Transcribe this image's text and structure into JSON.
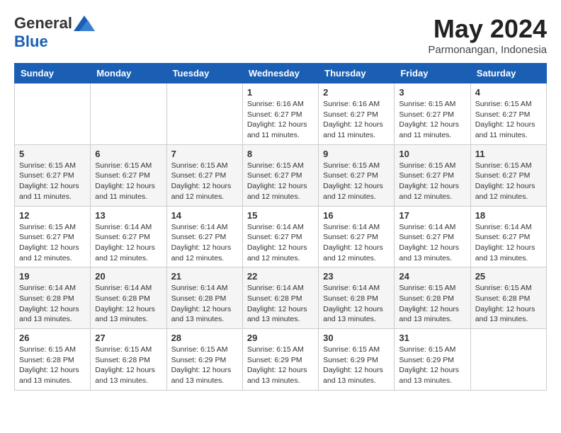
{
  "header": {
    "logo": {
      "general": "General",
      "blue": "Blue"
    },
    "title": "May 2024",
    "location": "Parmonangan, Indonesia"
  },
  "days_of_week": [
    "Sunday",
    "Monday",
    "Tuesday",
    "Wednesday",
    "Thursday",
    "Friday",
    "Saturday"
  ],
  "weeks": [
    [
      {
        "day": "",
        "info": ""
      },
      {
        "day": "",
        "info": ""
      },
      {
        "day": "",
        "info": ""
      },
      {
        "day": "1",
        "info": "Sunrise: 6:16 AM\nSunset: 6:27 PM\nDaylight: 12 hours and 11 minutes."
      },
      {
        "day": "2",
        "info": "Sunrise: 6:16 AM\nSunset: 6:27 PM\nDaylight: 12 hours and 11 minutes."
      },
      {
        "day": "3",
        "info": "Sunrise: 6:15 AM\nSunset: 6:27 PM\nDaylight: 12 hours and 11 minutes."
      },
      {
        "day": "4",
        "info": "Sunrise: 6:15 AM\nSunset: 6:27 PM\nDaylight: 12 hours and 11 minutes."
      }
    ],
    [
      {
        "day": "5",
        "info": "Sunrise: 6:15 AM\nSunset: 6:27 PM\nDaylight: 12 hours and 11 minutes."
      },
      {
        "day": "6",
        "info": "Sunrise: 6:15 AM\nSunset: 6:27 PM\nDaylight: 12 hours and 11 minutes."
      },
      {
        "day": "7",
        "info": "Sunrise: 6:15 AM\nSunset: 6:27 PM\nDaylight: 12 hours and 12 minutes."
      },
      {
        "day": "8",
        "info": "Sunrise: 6:15 AM\nSunset: 6:27 PM\nDaylight: 12 hours and 12 minutes."
      },
      {
        "day": "9",
        "info": "Sunrise: 6:15 AM\nSunset: 6:27 PM\nDaylight: 12 hours and 12 minutes."
      },
      {
        "day": "10",
        "info": "Sunrise: 6:15 AM\nSunset: 6:27 PM\nDaylight: 12 hours and 12 minutes."
      },
      {
        "day": "11",
        "info": "Sunrise: 6:15 AM\nSunset: 6:27 PM\nDaylight: 12 hours and 12 minutes."
      }
    ],
    [
      {
        "day": "12",
        "info": "Sunrise: 6:15 AM\nSunset: 6:27 PM\nDaylight: 12 hours and 12 minutes."
      },
      {
        "day": "13",
        "info": "Sunrise: 6:14 AM\nSunset: 6:27 PM\nDaylight: 12 hours and 12 minutes."
      },
      {
        "day": "14",
        "info": "Sunrise: 6:14 AM\nSunset: 6:27 PM\nDaylight: 12 hours and 12 minutes."
      },
      {
        "day": "15",
        "info": "Sunrise: 6:14 AM\nSunset: 6:27 PM\nDaylight: 12 hours and 12 minutes."
      },
      {
        "day": "16",
        "info": "Sunrise: 6:14 AM\nSunset: 6:27 PM\nDaylight: 12 hours and 12 minutes."
      },
      {
        "day": "17",
        "info": "Sunrise: 6:14 AM\nSunset: 6:27 PM\nDaylight: 12 hours and 13 minutes."
      },
      {
        "day": "18",
        "info": "Sunrise: 6:14 AM\nSunset: 6:27 PM\nDaylight: 12 hours and 13 minutes."
      }
    ],
    [
      {
        "day": "19",
        "info": "Sunrise: 6:14 AM\nSunset: 6:28 PM\nDaylight: 12 hours and 13 minutes."
      },
      {
        "day": "20",
        "info": "Sunrise: 6:14 AM\nSunset: 6:28 PM\nDaylight: 12 hours and 13 minutes."
      },
      {
        "day": "21",
        "info": "Sunrise: 6:14 AM\nSunset: 6:28 PM\nDaylight: 12 hours and 13 minutes."
      },
      {
        "day": "22",
        "info": "Sunrise: 6:14 AM\nSunset: 6:28 PM\nDaylight: 12 hours and 13 minutes."
      },
      {
        "day": "23",
        "info": "Sunrise: 6:14 AM\nSunset: 6:28 PM\nDaylight: 12 hours and 13 minutes."
      },
      {
        "day": "24",
        "info": "Sunrise: 6:15 AM\nSunset: 6:28 PM\nDaylight: 12 hours and 13 minutes."
      },
      {
        "day": "25",
        "info": "Sunrise: 6:15 AM\nSunset: 6:28 PM\nDaylight: 12 hours and 13 minutes."
      }
    ],
    [
      {
        "day": "26",
        "info": "Sunrise: 6:15 AM\nSunset: 6:28 PM\nDaylight: 12 hours and 13 minutes."
      },
      {
        "day": "27",
        "info": "Sunrise: 6:15 AM\nSunset: 6:28 PM\nDaylight: 12 hours and 13 minutes."
      },
      {
        "day": "28",
        "info": "Sunrise: 6:15 AM\nSunset: 6:29 PM\nDaylight: 12 hours and 13 minutes."
      },
      {
        "day": "29",
        "info": "Sunrise: 6:15 AM\nSunset: 6:29 PM\nDaylight: 12 hours and 13 minutes."
      },
      {
        "day": "30",
        "info": "Sunrise: 6:15 AM\nSunset: 6:29 PM\nDaylight: 12 hours and 13 minutes."
      },
      {
        "day": "31",
        "info": "Sunrise: 6:15 AM\nSunset: 6:29 PM\nDaylight: 12 hours and 13 minutes."
      },
      {
        "day": "",
        "info": ""
      }
    ]
  ]
}
